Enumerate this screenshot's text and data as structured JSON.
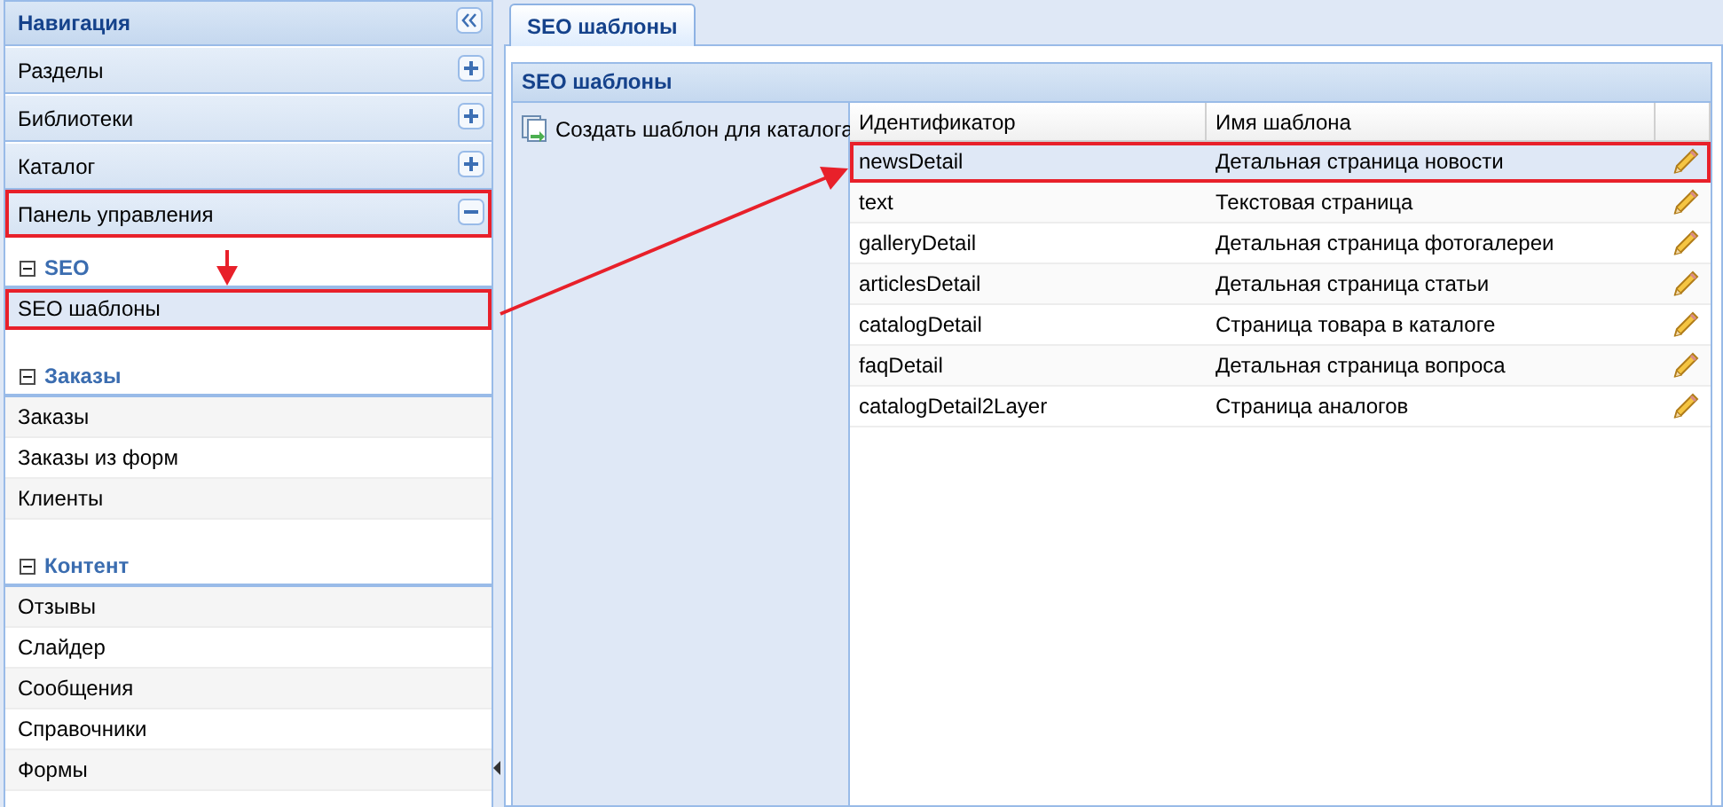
{
  "navigation": {
    "title": "Навигация",
    "sections": [
      {
        "title": "Разделы",
        "expanded": false,
        "highlighted": false
      },
      {
        "title": "Библиотеки",
        "expanded": false,
        "highlighted": false
      },
      {
        "title": "Каталог",
        "expanded": false,
        "highlighted": false
      },
      {
        "title": "Панель управления",
        "expanded": true,
        "highlighted": true,
        "groups": [
          {
            "title": "SEO",
            "expanded": true,
            "items": [
              {
                "label": "SEO шаблоны",
                "selected": true,
                "highlighted": true
              }
            ]
          },
          {
            "title": "Заказы",
            "expanded": true,
            "items": [
              {
                "label": "Заказы",
                "selected": false,
                "highlighted": false
              },
              {
                "label": "Заказы из форм",
                "selected": false,
                "highlighted": false
              },
              {
                "label": "Клиенты",
                "selected": false,
                "highlighted": false
              }
            ]
          },
          {
            "title": "Контент",
            "expanded": true,
            "items": [
              {
                "label": "Отзывы",
                "selected": false,
                "highlighted": false
              },
              {
                "label": "Слайдер",
                "selected": false,
                "highlighted": false
              },
              {
                "label": "Сообщения",
                "selected": false,
                "highlighted": false
              },
              {
                "label": "Справочники",
                "selected": false,
                "highlighted": false
              },
              {
                "label": "Формы",
                "selected": false,
                "highlighted": false
              }
            ]
          }
        ]
      }
    ]
  },
  "tabs": [
    {
      "label": "SEO шаблоны",
      "selected": true
    }
  ],
  "panel": {
    "title": "SEO шаблоны",
    "create_button": "Создать шаблон для каталога",
    "table": {
      "columns": [
        "Идентификатор",
        "Имя шаблона"
      ],
      "rows": [
        {
          "cells": [
            "newsDetail",
            "Детальная страница новости"
          ],
          "selected": true,
          "highlighted": true
        },
        {
          "cells": [
            "text",
            "Текстовая страница"
          ],
          "selected": false,
          "highlighted": false
        },
        {
          "cells": [
            "galleryDetail",
            "Детальная страница фотогалереи"
          ],
          "selected": false,
          "highlighted": false
        },
        {
          "cells": [
            "articlesDetail",
            "Детальная страница статьи"
          ],
          "selected": false,
          "highlighted": false
        },
        {
          "cells": [
            "catalogDetail",
            "Страница товара в каталоге"
          ],
          "selected": false,
          "highlighted": false
        },
        {
          "cells": [
            "faqDetail",
            "Детальная страница вопроса"
          ],
          "selected": false,
          "highlighted": false
        },
        {
          "cells": [
            "catalogDetail2Layer",
            "Страница аналогов"
          ],
          "selected": false,
          "highlighted": false
        }
      ]
    }
  }
}
